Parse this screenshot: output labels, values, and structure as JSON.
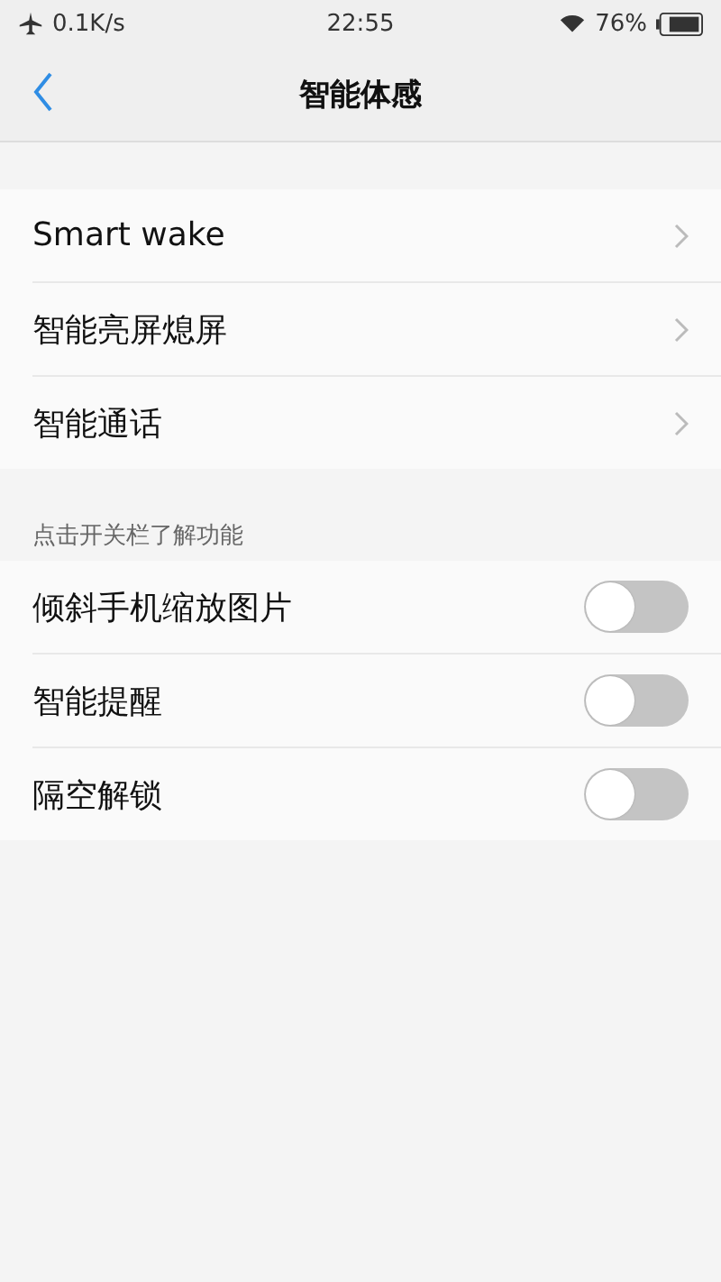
{
  "status_bar": {
    "speed": "0.1K/s",
    "time": "22:55",
    "battery": "76%"
  },
  "header": {
    "title": "智能体感"
  },
  "nav_items": [
    {
      "label": "Smart wake"
    },
    {
      "label": "智能亮屏熄屏"
    },
    {
      "label": "智能通话"
    }
  ],
  "section": {
    "hint": "点击开关栏了解功能"
  },
  "toggles": [
    {
      "label": "倾斜手机缩放图片",
      "on": false
    },
    {
      "label": "智能提醒",
      "on": false
    },
    {
      "label": "隔空解锁",
      "on": false
    }
  ]
}
